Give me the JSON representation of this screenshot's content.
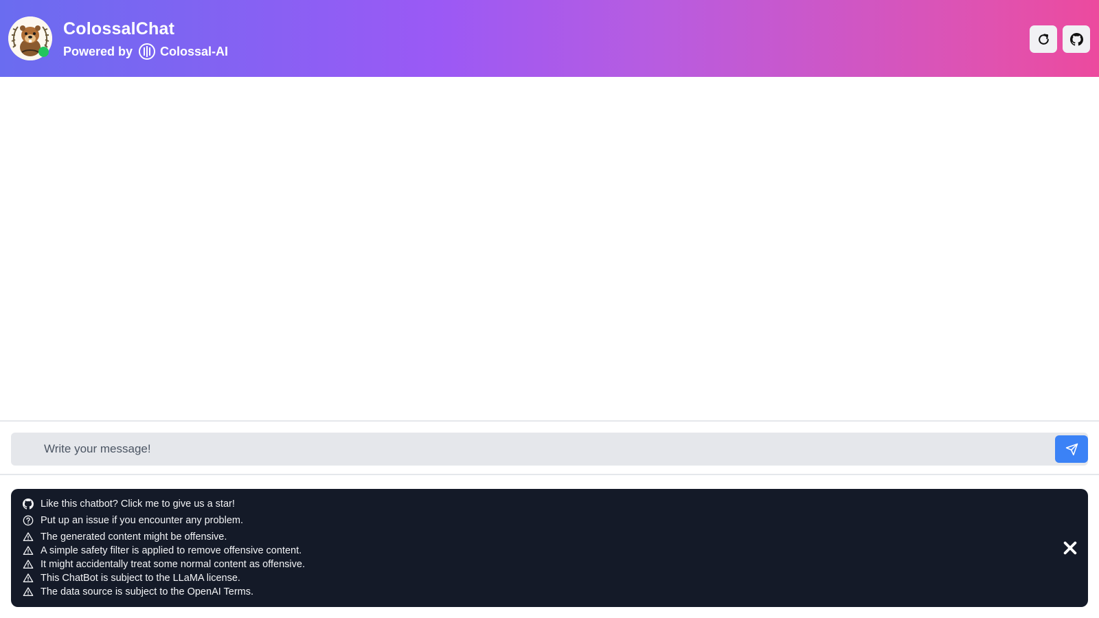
{
  "header": {
    "title": "ColossalChat",
    "powered_by_label": "Powered by",
    "brand_name": "Colossal-AI",
    "avatar_icon": "beaver-mascot-icon",
    "status": "online",
    "buttons": [
      {
        "name": "refresh",
        "icon": "refresh-icon"
      },
      {
        "name": "github",
        "icon": "github-icon"
      }
    ]
  },
  "composer": {
    "placeholder": "Write your message!",
    "value": "",
    "send_icon": "send-icon"
  },
  "notice": {
    "items": [
      {
        "icon": "github-icon",
        "text": "Like this chatbot? Click me to give us a star!"
      },
      {
        "icon": "question-circle-icon",
        "text": "Put up an issue if you encounter any problem."
      },
      {
        "icon": "warning-icon",
        "text": "The generated content might be offensive."
      },
      {
        "icon": "warning-icon",
        "text": "A simple safety filter is applied to remove offensive content."
      },
      {
        "icon": "warning-icon",
        "text": "It might accidentally treat some normal content as offensive."
      },
      {
        "icon": "warning-icon",
        "text": "This ChatBot is subject to the LLaMA license."
      },
      {
        "icon": "warning-icon",
        "text": "The data source is subject to the OpenAI Terms."
      }
    ],
    "close_icon": "close-icon"
  },
  "colors": {
    "header_gradient_start": "#6a6cf0",
    "header_gradient_end": "#ec4a9e",
    "send_button": "#3b82f6",
    "notice_background": "#141a28",
    "status_dot": "#22c55e"
  }
}
